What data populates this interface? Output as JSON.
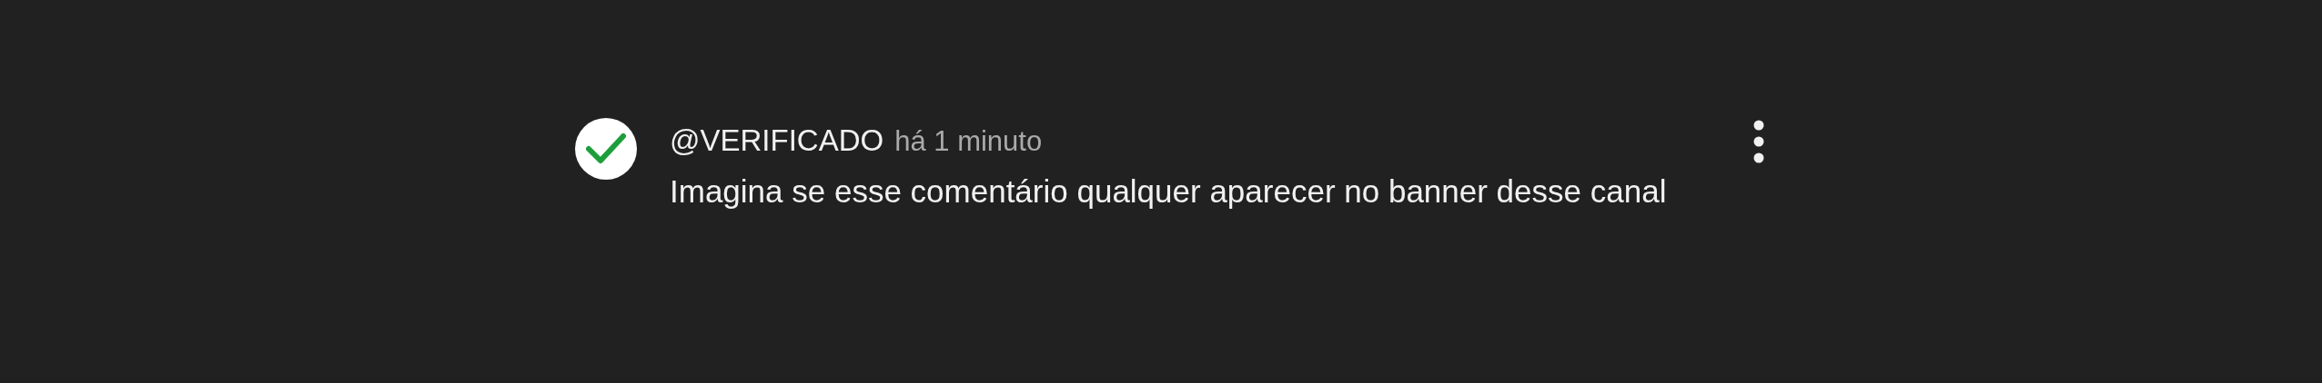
{
  "comment": {
    "author": "@VERIFICADO",
    "time": "há 1 minuto",
    "text": "Imagina se esse comentário qualquer aparecer no banner desse canal",
    "verified": true
  }
}
